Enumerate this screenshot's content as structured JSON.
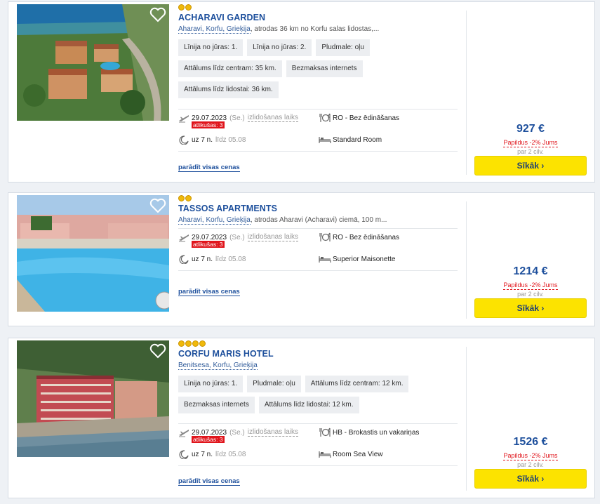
{
  "ui": {
    "show_all_prices": "parādīt visas cenas",
    "book_label": "Sīkāk ›",
    "spots_left": "atlikušas: 3",
    "departure_time_label": "izlidošanas laiks",
    "nights_prefix": "uz 7 n.",
    "extra_discount": "Papildus -2% Jums",
    "per_person": "par 2 cilv.",
    "heart_color": "#ffffff",
    "accent_color": "#1d4f9c",
    "button_color": "#fce300"
  },
  "hotels": [
    {
      "name": "ACHARAVI GARDEN",
      "stars": 2,
      "location_link": "Aharavi, Korfu, Grieķija",
      "location_rest": ", atrodas 36 km no Korfu salas lidostas,...",
      "tags": [
        "Līnija no jūras: 1.",
        "Līnija no jūras: 2.",
        "Pludmale: oļu",
        "Attālums līdz centram: 35 km.",
        "Bezmaksas internets",
        "Attālums līdz lidostai: 36 km."
      ],
      "date": "29.07.2023",
      "weekday": "(Se.)",
      "return": "līdz 05.08",
      "board": "RO - Bez ēdināšanas",
      "room": "Standard Room",
      "price": "927 €",
      "photo": "aerial-garden"
    },
    {
      "name": "TASSOS APARTMENTS",
      "stars": 2,
      "location_link": "Aharavi, Korfu, Grieķija",
      "location_rest": ", atrodas Aharavi (Acharavi) ciemā, 100 m...",
      "tags": [],
      "date": "29.07.2023",
      "weekday": "(Se.)",
      "return": "līdz 05.08",
      "board": "RO - Bez ēdināšanas",
      "room": "Superior Maisonette",
      "price": "1214 €",
      "photo": "pool"
    },
    {
      "name": "CORFU MARIS HOTEL",
      "stars": 4,
      "location_link": "Benitsesa, Korfu, Grieķija",
      "location_rest": "",
      "tags": [
        "Līnija no jūras: 1.",
        "Pludmale: oļu",
        "Attālums līdz centram: 12 km.",
        "Bezmaksas internets",
        "Attālums līdz lidostai: 12 km."
      ],
      "date": "29.07.2023",
      "weekday": "(Se.)",
      "return": "līdz 05.08",
      "board": "HB - Brokastis un vakariņas",
      "room": "Room Sea View",
      "price": "1526 €",
      "photo": "seaside-hotel"
    }
  ]
}
